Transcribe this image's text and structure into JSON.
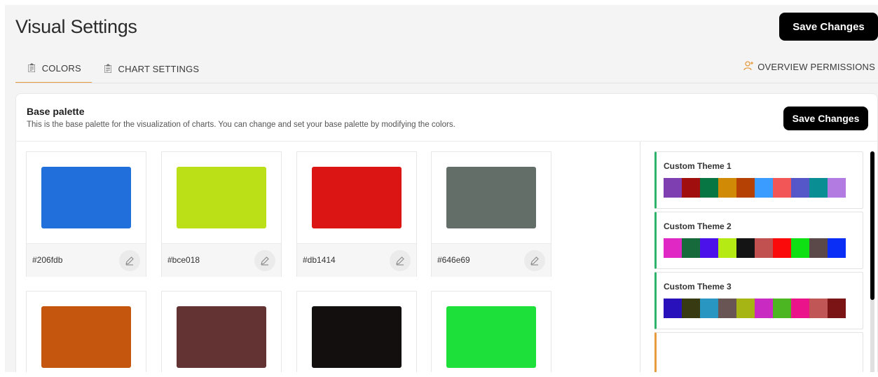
{
  "header": {
    "title": "Visual Settings",
    "save_label": "Save Changes"
  },
  "tabs": [
    {
      "label": "COLORS",
      "icon": "clipboard-icon",
      "active": true
    },
    {
      "label": "CHART SETTINGS",
      "icon": "clipboard-icon",
      "active": false
    }
  ],
  "permissions": {
    "label": "OVERVIEW PERMISSIONS",
    "icon": "user-plus-icon"
  },
  "card": {
    "title": "Base palette",
    "description": "This is the base palette for the visualization of charts. You can change and set your base palette by modifying the colors.",
    "save_label": "Save Changes"
  },
  "palette": [
    {
      "hex": "#206fdb",
      "color": "#206fdb"
    },
    {
      "hex": "#bce018",
      "color": "#bce018"
    },
    {
      "hex": "#db1414",
      "color": "#db1414"
    },
    {
      "hex": "#646e69",
      "color": "#646e69"
    },
    {
      "hex": "",
      "color": "#c5560e"
    },
    {
      "hex": "",
      "color": "#633333"
    },
    {
      "hex": "",
      "color": "#120f0e"
    },
    {
      "hex": "",
      "color": "#1ee03a"
    }
  ],
  "themes": [
    {
      "name": "Custom Theme 1",
      "colors": [
        "#7e3fb0",
        "#a10e0e",
        "#087642",
        "#d18a05",
        "#b54104",
        "#3b9cff",
        "#f25656",
        "#5556c7",
        "#088e93",
        "#b27be1"
      ]
    },
    {
      "name": "Custom Theme 2",
      "colors": [
        "#e029c4",
        "#166a3c",
        "#4c12ea",
        "#b6ea14",
        "#141414",
        "#c15151",
        "#fa0a0a",
        "#0ee014",
        "#5b4848",
        "#0a2ef5"
      ]
    },
    {
      "name": "Custom Theme 3",
      "colors": [
        "#2811bb",
        "#383a12",
        "#2996c2",
        "#6a5555",
        "#a6b513",
        "#c92bc2",
        "#4cb622",
        "#ea138a",
        "#c15656",
        "#7b1414"
      ]
    },
    {
      "name": "",
      "colors": []
    }
  ],
  "accent_color": "#e69c3f",
  "theme_accent_color": "#2fb36b"
}
